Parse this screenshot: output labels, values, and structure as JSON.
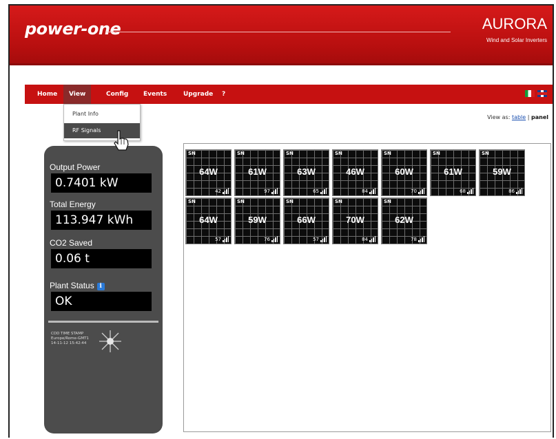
{
  "header": {
    "logo": "power-one",
    "title": "AURORA",
    "subtitle": "Wind and Solar Inverters",
    "header_color": "#c61111"
  },
  "nav": {
    "items": [
      "Home",
      "View",
      "Config",
      "Events",
      "Upgrade",
      "?"
    ],
    "active": "View",
    "dropdown": [
      "Plant Info",
      "RF Signals"
    ],
    "dropdown_highlight": "RF Signals",
    "languages": [
      "italian-flag-icon",
      "uk-flag-icon"
    ]
  },
  "view_as": {
    "label": "View as:",
    "table": "table",
    "separator": "|",
    "panel": "panel"
  },
  "status": {
    "output_power_label": "Output Power",
    "output_power_value": "0.7401 kW",
    "total_energy_label": "Total Energy",
    "total_energy_value": "113.947 kWh",
    "co2_label": "CO2 Saved",
    "co2_value": "0.06 t",
    "plant_status_label": "Plant Status",
    "plant_status_value": "OK",
    "timestamp_title": "CDD TIME STAMP",
    "timezone": "Europe/Rome-GMT1",
    "datetime": "14-11-12 15:42:44"
  },
  "panels": [
    {
      "sn": "SN",
      "power": "64W",
      "signal": "42"
    },
    {
      "sn": "SN",
      "power": "61W",
      "signal": "97"
    },
    {
      "sn": "SN",
      "power": "63W",
      "signal": "65"
    },
    {
      "sn": "SN",
      "power": "46W",
      "signal": "84"
    },
    {
      "sn": "SN",
      "power": "60W",
      "signal": "70"
    },
    {
      "sn": "SN",
      "power": "61W",
      "signal": "68"
    },
    {
      "sn": "SN",
      "power": "59W",
      "signal": "86"
    },
    {
      "sn": "SN",
      "power": "64W",
      "signal": "57"
    },
    {
      "sn": "SN",
      "power": "59W",
      "signal": "76"
    },
    {
      "sn": "SN",
      "power": "66W",
      "signal": "57"
    },
    {
      "sn": "SN",
      "power": "70W",
      "signal": "84"
    },
    {
      "sn": "SN",
      "power": "62W",
      "signal": "78"
    }
  ]
}
